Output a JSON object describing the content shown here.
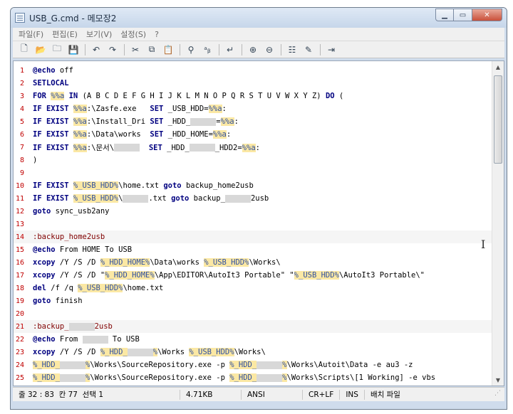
{
  "window": {
    "title": "USB_G.cmd - 메모장2",
    "min_icon": "minimize-icon",
    "max_icon": "maximize-icon",
    "close_icon": "close-icon"
  },
  "menu": [
    "파일(F)",
    "편집(E)",
    "보기(V)",
    "설정(S)",
    "?"
  ],
  "toolbar_icons": [
    "new-file-icon",
    "open-folder-icon",
    "browse-icon",
    "save-icon",
    "undo-icon",
    "redo-icon",
    "cut-icon",
    "copy-icon",
    "paste-icon",
    "find-icon",
    "replace-icon",
    "word-wrap-icon",
    "zoom-in-icon",
    "zoom-out-icon",
    "settings-icon",
    "edit-icon",
    "exit-icon"
  ],
  "lines": [
    {
      "n": "1",
      "segs": [
        {
          "t": "kw",
          "v": "@echo"
        },
        {
          "t": "",
          "v": " off"
        }
      ]
    },
    {
      "n": "2",
      "segs": [
        {
          "t": "kw",
          "v": "SETLOCAL"
        }
      ]
    },
    {
      "n": "3",
      "segs": [
        {
          "t": "kw",
          "v": "FOR"
        },
        {
          "t": "",
          "v": " "
        },
        {
          "t": "var",
          "v": "%%a"
        },
        {
          "t": "",
          "v": " "
        },
        {
          "t": "kw",
          "v": "IN"
        },
        {
          "t": "",
          "v": " (A B C D E F G H I J K L M N O P Q R S T U V W X Y Z) "
        },
        {
          "t": "kw",
          "v": "DO"
        },
        {
          "t": "",
          "v": " ("
        }
      ]
    },
    {
      "n": "4",
      "segs": [
        {
          "t": "kw",
          "v": "IF EXIST"
        },
        {
          "t": "",
          "v": " "
        },
        {
          "t": "var",
          "v": "%%a"
        },
        {
          "t": "",
          "v": ":\\Zasfe.exe   "
        },
        {
          "t": "kw",
          "v": "SET"
        },
        {
          "t": "",
          "v": " _USB_HDD="
        },
        {
          "t": "var",
          "v": "%%a"
        },
        {
          "t": "",
          "v": ":"
        }
      ]
    },
    {
      "n": "5",
      "segs": [
        {
          "t": "kw",
          "v": "IF EXIST"
        },
        {
          "t": "",
          "v": " "
        },
        {
          "t": "var",
          "v": "%%a"
        },
        {
          "t": "",
          "v": ":\\Install_Dri "
        },
        {
          "t": "kw",
          "v": "SET"
        },
        {
          "t": "",
          "v": " _HDD_"
        },
        {
          "t": "blur",
          "v": ""
        },
        {
          "t": "",
          "v": "="
        },
        {
          "t": "var",
          "v": "%%a"
        },
        {
          "t": "",
          "v": ":"
        }
      ]
    },
    {
      "n": "6",
      "segs": [
        {
          "t": "kw",
          "v": "IF EXIST"
        },
        {
          "t": "",
          "v": " "
        },
        {
          "t": "var",
          "v": "%%a"
        },
        {
          "t": "",
          "v": ":\\Data\\works  "
        },
        {
          "t": "kw",
          "v": "SET"
        },
        {
          "t": "",
          "v": " _HDD_HOME="
        },
        {
          "t": "var",
          "v": "%%a"
        },
        {
          "t": "",
          "v": ":"
        }
      ]
    },
    {
      "n": "7",
      "segs": [
        {
          "t": "kw",
          "v": "IF EXIST"
        },
        {
          "t": "",
          "v": " "
        },
        {
          "t": "var",
          "v": "%%a"
        },
        {
          "t": "",
          "v": ":\\문서\\"
        },
        {
          "t": "blur",
          "v": ""
        },
        {
          "t": "",
          "v": "  "
        },
        {
          "t": "kw",
          "v": "SET"
        },
        {
          "t": "",
          "v": " _HDD_"
        },
        {
          "t": "blur",
          "v": ""
        },
        {
          "t": "",
          "v": "_HDD2="
        },
        {
          "t": "var",
          "v": "%%a"
        },
        {
          "t": "",
          "v": ":"
        }
      ]
    },
    {
      "n": "8",
      "segs": [
        {
          "t": "",
          "v": ")"
        }
      ]
    },
    {
      "n": "9",
      "segs": []
    },
    {
      "n": "10",
      "segs": [
        {
          "t": "kw",
          "v": "IF EXIST"
        },
        {
          "t": "",
          "v": " "
        },
        {
          "t": "var",
          "v": "%_USB_HDD%"
        },
        {
          "t": "",
          "v": "\\home.txt "
        },
        {
          "t": "kw",
          "v": "goto"
        },
        {
          "t": "",
          "v": " backup_home2usb"
        }
      ]
    },
    {
      "n": "11",
      "segs": [
        {
          "t": "kw",
          "v": "IF EXIST"
        },
        {
          "t": "",
          "v": " "
        },
        {
          "t": "var",
          "v": "%_USB_HDD%"
        },
        {
          "t": "",
          "v": "\\"
        },
        {
          "t": "blur",
          "v": ""
        },
        {
          "t": "",
          "v": ".txt "
        },
        {
          "t": "kw",
          "v": "goto"
        },
        {
          "t": "",
          "v": " backup_"
        },
        {
          "t": "blur",
          "v": ""
        },
        {
          "t": "",
          "v": "2usb"
        }
      ]
    },
    {
      "n": "12",
      "segs": [
        {
          "t": "kw",
          "v": "goto"
        },
        {
          "t": "",
          "v": " sync_usb2any"
        }
      ]
    },
    {
      "n": "13",
      "segs": []
    },
    {
      "n": "14",
      "cur": true,
      "segs": [
        {
          "t": "lbl",
          "v": ":backup_home2usb"
        }
      ]
    },
    {
      "n": "15",
      "segs": [
        {
          "t": "kw",
          "v": "@echo"
        },
        {
          "t": "",
          "v": " From HOME To USB"
        }
      ]
    },
    {
      "n": "16",
      "segs": [
        {
          "t": "kw",
          "v": "xcopy"
        },
        {
          "t": "",
          "v": " /Y /S /D "
        },
        {
          "t": "var",
          "v": "%_HDD_HOME%"
        },
        {
          "t": "",
          "v": "\\Data\\works "
        },
        {
          "t": "var",
          "v": "%_USB_HDD%"
        },
        {
          "t": "",
          "v": "\\Works\\"
        }
      ]
    },
    {
      "n": "17",
      "segs": [
        {
          "t": "kw",
          "v": "xcopy"
        },
        {
          "t": "",
          "v": " /Y /S /D \""
        },
        {
          "t": "var",
          "v": "%_HDD_HOME%"
        },
        {
          "t": "",
          "v": "\\App\\EDITOR\\AutoIt3 Portable\" \""
        },
        {
          "t": "var",
          "v": "%_USB_HDD%"
        },
        {
          "t": "",
          "v": "\\AutoIt3 Portable\\\""
        }
      ]
    },
    {
      "n": "18",
      "segs": [
        {
          "t": "kw",
          "v": "del"
        },
        {
          "t": "",
          "v": " /f /q "
        },
        {
          "t": "var",
          "v": "%_USB_HDD%"
        },
        {
          "t": "",
          "v": "\\home.txt"
        }
      ]
    },
    {
      "n": "19",
      "segs": [
        {
          "t": "kw",
          "v": "goto"
        },
        {
          "t": "",
          "v": " finish"
        }
      ]
    },
    {
      "n": "20",
      "segs": []
    },
    {
      "n": "21",
      "cur": true,
      "segs": [
        {
          "t": "lbl",
          "v": ":backup_"
        },
        {
          "t": "blur",
          "v": ""
        },
        {
          "t": "lbl",
          "v": "2usb"
        }
      ]
    },
    {
      "n": "22",
      "segs": [
        {
          "t": "kw",
          "v": "@echo"
        },
        {
          "t": "",
          "v": " From "
        },
        {
          "t": "blur",
          "v": ""
        },
        {
          "t": "",
          "v": " To USB"
        }
      ]
    },
    {
      "n": "23",
      "segs": [
        {
          "t": "kw",
          "v": "xcopy"
        },
        {
          "t": "",
          "v": " /Y /S /D "
        },
        {
          "t": "var",
          "v": "%_HDD_"
        },
        {
          "t": "blur",
          "v": ""
        },
        {
          "t": "var",
          "v": "%"
        },
        {
          "t": "",
          "v": "\\Works "
        },
        {
          "t": "var",
          "v": "%_USB_HDD%"
        },
        {
          "t": "",
          "v": "\\Works\\"
        }
      ]
    },
    {
      "n": "24",
      "segs": [
        {
          "t": "var",
          "v": "%_HDD_"
        },
        {
          "t": "blur",
          "v": ""
        },
        {
          "t": "var",
          "v": "%"
        },
        {
          "t": "",
          "v": "\\Works\\SourceRepository.exe -p "
        },
        {
          "t": "var",
          "v": "%_HDD_"
        },
        {
          "t": "blur",
          "v": ""
        },
        {
          "t": "var",
          "v": "%"
        },
        {
          "t": "",
          "v": "\\Works\\Autoit\\Data -e au3 -z"
        }
      ]
    },
    {
      "n": "25",
      "segs": [
        {
          "t": "var",
          "v": "%_HDD_"
        },
        {
          "t": "blur",
          "v": ""
        },
        {
          "t": "var",
          "v": "%"
        },
        {
          "t": "",
          "v": "\\Works\\SourceRepository.exe -p "
        },
        {
          "t": "var",
          "v": "%_HDD_"
        },
        {
          "t": "blur",
          "v": ""
        },
        {
          "t": "var",
          "v": "%"
        },
        {
          "t": "",
          "v": "\\Works\\Scripts\\[1 Working] -e vbs"
        }
      ]
    }
  ],
  "status": {
    "position": "줄 32 : 83",
    "column": "칸 77",
    "selection": "선택 1",
    "size": "4.71KB",
    "encoding": "ANSI",
    "line_ending": "CR+LF",
    "mode": "INS",
    "file_type": "배치 파일"
  }
}
